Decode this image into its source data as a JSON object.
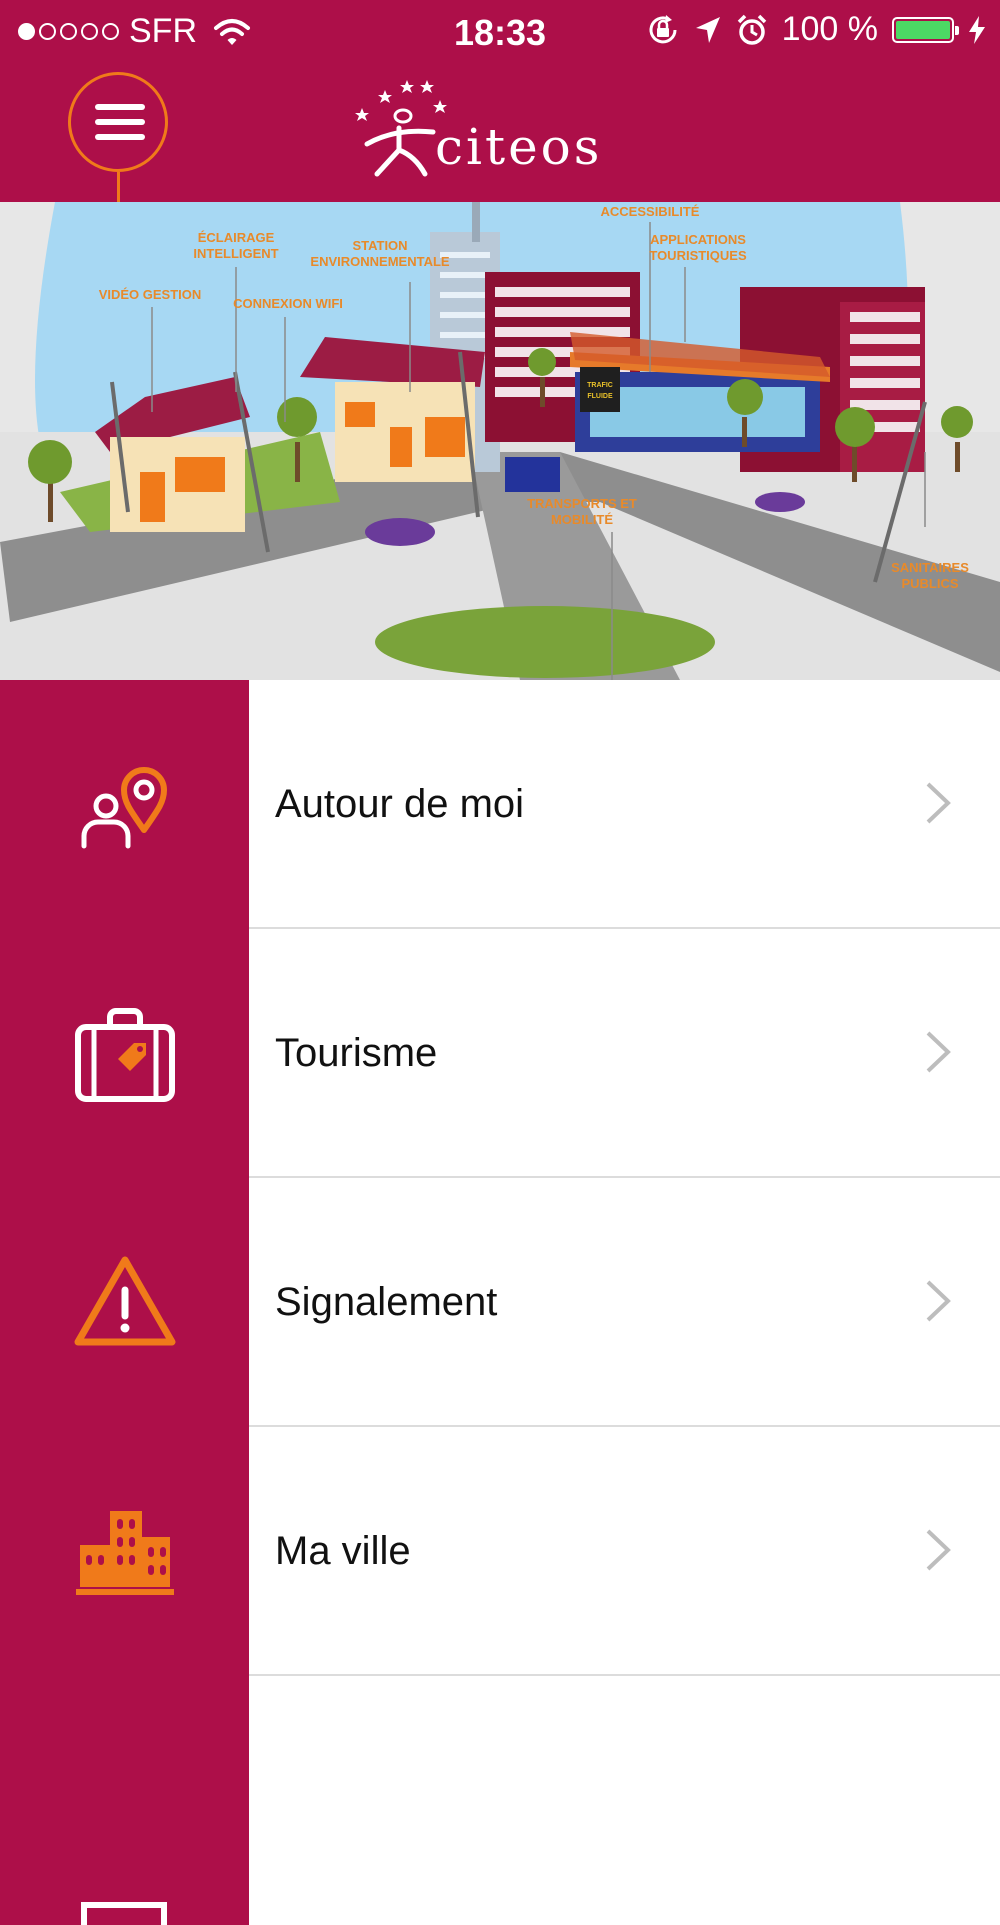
{
  "status_bar": {
    "carrier": "SFR",
    "time": "18:33",
    "battery": "100 %",
    "battery_level": 1.0,
    "signal_bars": 1
  },
  "header": {
    "logo_text": "citeos",
    "menu_icon": "hamburger-icon"
  },
  "hero": {
    "labels": {
      "video": "VIDÉO GESTION",
      "eclairage1": "ÉCLAIRAGE",
      "eclairage2": "INTELLIGENT",
      "wifi": "CONNEXION WIFI",
      "station1": "STATION",
      "station2": "ENVIRONNEMENTALE",
      "accessibilite": "ACCESSIBILITÉ",
      "applications1": "APPLICATIONS",
      "applications2": "TOURISTIQUES",
      "transports1": "TRANSPORTS ET",
      "transports2": "MOBILITÉ",
      "sanitaires1": "SANITAIRES",
      "sanitaires2": "PUBLICS",
      "trafic1": "TRAFIC",
      "trafic2": "FLUIDE"
    }
  },
  "menu": {
    "items": [
      {
        "label": "Autour de moi",
        "icon": "people-location-icon"
      },
      {
        "label": "Tourisme",
        "icon": "suitcase-icon"
      },
      {
        "label": "Signalement",
        "icon": "warning-icon"
      },
      {
        "label": "Ma ville",
        "icon": "city-buildings-icon"
      },
      {
        "label": "",
        "icon": "partial-icon"
      }
    ]
  },
  "colors": {
    "brand": "#ad0f49",
    "accent": "#f07a1a",
    "divider": "#dcdcdc"
  }
}
